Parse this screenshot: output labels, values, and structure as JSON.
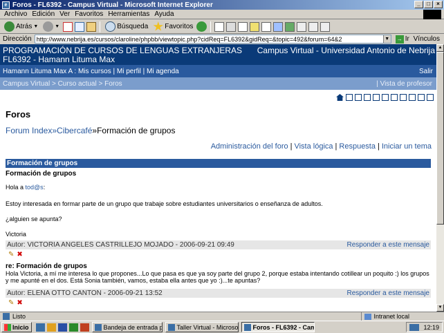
{
  "window": {
    "title": "Foros - FL6392 - Campus Virtual - Microsoft Internet Explorer"
  },
  "menu": [
    "Archivo",
    "Edición",
    "Ver",
    "Favoritos",
    "Herramientas",
    "Ayuda"
  ],
  "toolbar": {
    "back": "Atrás",
    "search": "Búsqueda",
    "favorites": "Favoritos"
  },
  "address": {
    "label": "Dirección",
    "url": "http://www.nebrija.es/cursos/claroline/phpbb/viewtopic.php?cidReq=FL6392&gidReq=&topic=492&forum=64&2",
    "go": "Ir",
    "links": "Vínculos"
  },
  "banner": {
    "left_line1": "PROGRAMACIÓN DE CURSOS DE LENGUAS EXTRANJERAS",
    "left_line2": "FL6392 - Hamann Lituma Max",
    "right": "Campus Virtual - Universidad Antonio de Nebrija"
  },
  "userbar": {
    "text": "Hamann Lituma Max A : Mis cursos  |  Mi perfil  |  Mi agenda",
    "logout": "Salir"
  },
  "breadcrumb": {
    "text": "Campus Virtual > Curso actual > Foros",
    "teacher_view": "|  Vista de profesor"
  },
  "page": {
    "title": "Foros",
    "path_index": "Forum Index",
    "path_sep1": "» ",
    "path_forum": "»Cibercafé",
    "path_sep2": "» ",
    "path_topic": "»Formación de grupos",
    "actions": [
      "Administración del foro",
      "Vista lógica",
      "Respuesta",
      "Iniciar un tema"
    ]
  },
  "thread": {
    "header": "Formación de grupos",
    "posts": [
      {
        "title": "Formación de grupos",
        "greeting_prefix": "Hola a ",
        "greeting_link": "tod@s",
        "greeting_suffix": ":",
        "body1": "Estoy interesada en formar parte de un grupo que trabaje sobre estudiantes universitarios o enseñanza de adultos.",
        "body2": "¿alguien se apunta?",
        "signature": "Victoria",
        "author": "Autor: VICTORIA ANGELES CASTRILLEJO MOJADO - 2006-09-21 09:49",
        "reply": "Responder a este mensaje"
      },
      {
        "title": "re: Formación de grupos",
        "body": "Hola Victoria, a mí me interesa lo que propones...Lo que pasa es que ya soy parte del grupo 2, porque estaba intentando cotillear un poquito :) los grupos y me apunté en el dos. Está Sonia también, vamos, estaba ella antes que yo :)...te apuntas?",
        "author": "Autor: ELENA OTTO CANTON - 2006-09-21 13:52",
        "reply": "Responder a este mensaje"
      }
    ]
  },
  "status": {
    "left": "Listo",
    "zone": "Intranet local"
  },
  "taskbar": {
    "start": "Inicio",
    "tasks": [
      "Bandeja de entrada para ...",
      "Taller Virtual - Microsoft ...",
      "Foros - FL6392 - Camp..."
    ],
    "clock": "12:19"
  }
}
